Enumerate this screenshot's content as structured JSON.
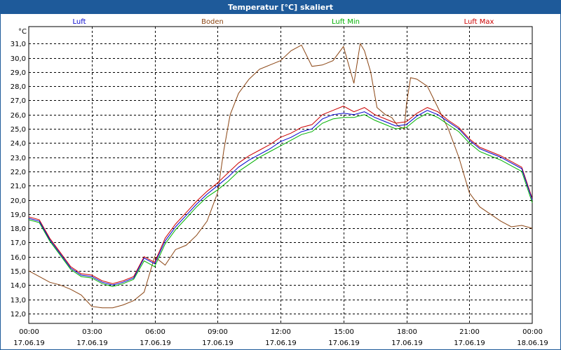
{
  "window": {
    "title": "Temperatur [°C] skaliert"
  },
  "colors": {
    "titlebar": "#1e5a9a",
    "luft": "#0000cc",
    "boden": "#8b4513",
    "luft_min": "#00b000",
    "luft_max": "#cc0000"
  },
  "chart_data": {
    "type": "line",
    "title": "Temperatur [°C] skaliert",
    "ylabel": "°C",
    "xlabel": "",
    "ylim": [
      11.3,
      32.2
    ],
    "grid": true,
    "legend": "top",
    "y_ticks": [
      "12,0",
      "13,0",
      "14,0",
      "15,0",
      "16,0",
      "17,0",
      "18,0",
      "19,0",
      "20,0",
      "21,0",
      "22,0",
      "23,0",
      "24,0",
      "25,0",
      "26,0",
      "27,0",
      "28,0",
      "29,0",
      "30,0",
      "31,0"
    ],
    "x_ticks": [
      {
        "time": "00:00",
        "date": "17.06.19"
      },
      {
        "time": "03:00",
        "date": "17.06.19"
      },
      {
        "time": "06:00",
        "date": "17.06.19"
      },
      {
        "time": "09:00",
        "date": "17.06.19"
      },
      {
        "time": "12:00",
        "date": "17.06.19"
      },
      {
        "time": "15:00",
        "date": "17.06.19"
      },
      {
        "time": "18:00",
        "date": "17.06.19"
      },
      {
        "time": "21:00",
        "date": "17.06.19"
      },
      {
        "time": "00:00",
        "date": "18.06.19"
      }
    ],
    "series": [
      {
        "name": "Luft",
        "color": "#0000cc",
        "x": [
          0,
          0.5,
          1,
          1.5,
          2,
          2.5,
          3,
          3.5,
          4,
          4.5,
          5,
          5.5,
          6,
          6.5,
          7,
          7.5,
          8,
          8.5,
          9,
          9.5,
          10,
          10.5,
          11,
          11.5,
          12,
          12.5,
          13,
          13.5,
          14,
          14.5,
          15,
          15.5,
          16,
          16.5,
          17,
          17.5,
          18,
          18.5,
          19,
          19.5,
          20,
          20.5,
          21,
          21.5,
          22,
          22.5,
          23,
          23.5,
          24
        ],
        "y": [
          18.7,
          18.5,
          17.2,
          16.2,
          15.2,
          14.7,
          14.6,
          14.2,
          14.0,
          14.2,
          14.5,
          15.9,
          15.5,
          17.1,
          18.1,
          18.9,
          19.7,
          20.4,
          21.0,
          21.6,
          22.3,
          22.8,
          23.2,
          23.6,
          24.1,
          24.4,
          24.8,
          25.0,
          25.7,
          26.0,
          26.1,
          26.0,
          26.2,
          25.8,
          25.5,
          25.2,
          25.3,
          25.9,
          26.3,
          26.0,
          25.5,
          25.0,
          24.2,
          23.6,
          23.3,
          23.0,
          22.6,
          22.2,
          20.0
        ]
      },
      {
        "name": "Boden",
        "color": "#8b4513",
        "x": [
          0,
          0.5,
          1,
          1.5,
          2,
          2.5,
          3,
          3.5,
          4,
          4.5,
          5,
          5.5,
          6,
          6.5,
          7,
          7.5,
          8,
          8.5,
          9,
          9.3,
          9.6,
          10,
          10.5,
          11,
          11.5,
          12,
          12.5,
          13,
          13.5,
          14,
          14.5,
          15,
          15.5,
          15.8,
          16,
          16.3,
          16.6,
          17,
          17.3,
          17.6,
          17.9,
          18,
          18.2,
          18.5,
          19,
          19.5,
          20,
          20.5,
          21,
          21.5,
          22,
          22.5,
          23,
          23.5,
          24
        ],
        "y": [
          15.0,
          14.6,
          14.2,
          14.0,
          13.7,
          13.3,
          12.5,
          12.4,
          12.4,
          12.6,
          12.9,
          13.5,
          16.0,
          15.4,
          16.5,
          16.8,
          17.5,
          18.5,
          20.5,
          23.5,
          26.0,
          27.5,
          28.5,
          29.2,
          29.5,
          29.8,
          30.5,
          30.9,
          29.4,
          29.5,
          29.8,
          30.8,
          28.2,
          31.0,
          30.5,
          29.0,
          26.5,
          26.0,
          25.8,
          25.2,
          25.0,
          26.7,
          28.6,
          28.5,
          28.0,
          26.5,
          25.0,
          23.0,
          20.5,
          19.5,
          19.0,
          18.5,
          18.1,
          18.2,
          18.0
        ]
      },
      {
        "name": "Luft Min",
        "color": "#00b000",
        "x": [
          0,
          0.5,
          1,
          1.5,
          2,
          2.5,
          3,
          3.5,
          4,
          4.5,
          5,
          5.5,
          6,
          6.5,
          7,
          7.5,
          8,
          8.5,
          9,
          9.5,
          10,
          10.5,
          11,
          11.5,
          12,
          12.5,
          13,
          13.5,
          14,
          14.5,
          15,
          15.5,
          16,
          16.5,
          17,
          17.5,
          18,
          18.5,
          19,
          19.5,
          20,
          20.5,
          21,
          21.5,
          22,
          22.5,
          23,
          23.5,
          24
        ],
        "y": [
          18.6,
          18.4,
          17.1,
          16.1,
          15.1,
          14.6,
          14.5,
          14.1,
          13.9,
          14.1,
          14.4,
          15.7,
          15.3,
          16.9,
          17.9,
          18.7,
          19.5,
          20.2,
          20.7,
          21.3,
          22.0,
          22.5,
          23.0,
          23.4,
          23.8,
          24.2,
          24.6,
          24.8,
          25.4,
          25.7,
          25.8,
          25.8,
          26.0,
          25.6,
          25.3,
          25.0,
          25.1,
          25.7,
          26.1,
          25.8,
          25.3,
          24.8,
          24.0,
          23.4,
          23.1,
          22.8,
          22.4,
          22.0,
          19.8
        ]
      },
      {
        "name": "Luft Max",
        "color": "#cc0000",
        "x": [
          0,
          0.5,
          1,
          1.5,
          2,
          2.5,
          3,
          3.5,
          4,
          4.5,
          5,
          5.5,
          6,
          6.5,
          7,
          7.5,
          8,
          8.5,
          9,
          9.5,
          10,
          10.5,
          11,
          11.5,
          12,
          12.5,
          13,
          13.5,
          14,
          14.5,
          15,
          15.5,
          16,
          16.5,
          17,
          17.5,
          18,
          18.5,
          19,
          19.5,
          20,
          20.5,
          21,
          21.5,
          22,
          22.5,
          23,
          23.5,
          24
        ],
        "y": [
          18.8,
          18.6,
          17.3,
          16.3,
          15.3,
          14.8,
          14.7,
          14.3,
          14.1,
          14.3,
          14.6,
          16.0,
          15.6,
          17.3,
          18.3,
          19.1,
          19.9,
          20.6,
          21.2,
          21.9,
          22.6,
          23.1,
          23.5,
          23.9,
          24.4,
          24.7,
          25.1,
          25.3,
          26.0,
          26.3,
          26.6,
          26.2,
          26.5,
          26.0,
          25.7,
          25.4,
          25.5,
          26.1,
          26.5,
          26.2,
          25.6,
          25.1,
          24.3,
          23.7,
          23.4,
          23.1,
          22.7,
          22.3,
          20.1
        ]
      }
    ]
  }
}
